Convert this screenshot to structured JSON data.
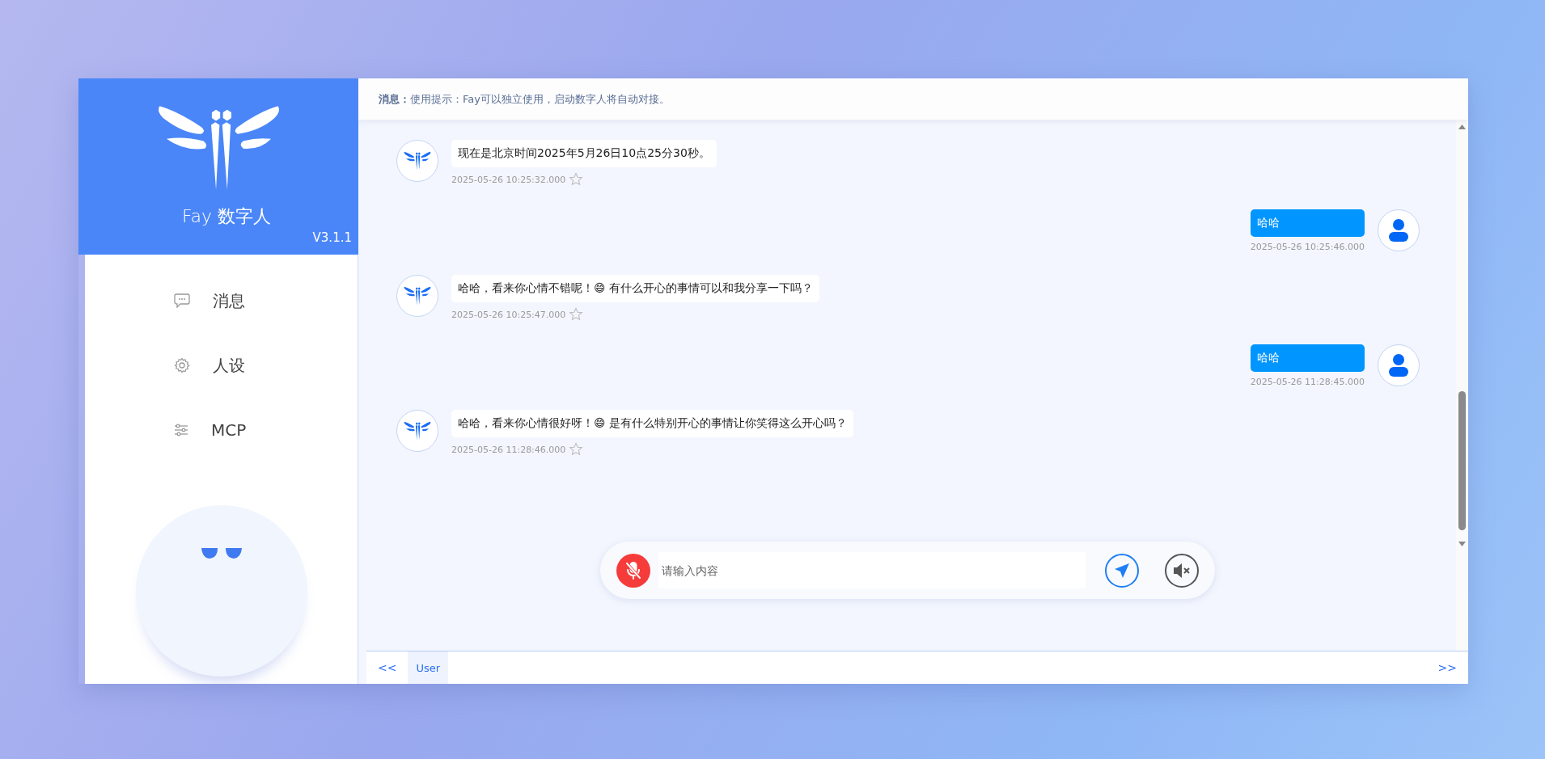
{
  "sidebar": {
    "app_name": "Fay 数字人",
    "version": "V3.1.1",
    "items": [
      {
        "label": "消息"
      },
      {
        "label": "人设"
      },
      {
        "label": "MCP"
      }
    ]
  },
  "header": {
    "label": "消息：",
    "text": "使用提示：Fay可以独立使用，启动数字人将自动对接。"
  },
  "messages": [
    {
      "kind": "bot",
      "text": "现在是北京时间2025年5月26日10点25分30秒。",
      "time": "2025-05-26 10:25:32.000",
      "starred": false
    },
    {
      "kind": "user",
      "text": "哈哈",
      "time": "2025-05-26 10:25:46.000"
    },
    {
      "kind": "bot",
      "text": "哈哈，看来你心情不错呢！😄 有什么开心的事情可以和我分享一下吗？",
      "time": "2025-05-26 10:25:47.000",
      "starred": false
    },
    {
      "kind": "user",
      "text": "哈哈",
      "time": "2025-05-26 11:28:45.000"
    },
    {
      "kind": "bot",
      "text": "哈哈，看来你心情很好呀！😄 是有什么特别开心的事情让你笑得这么开心吗？",
      "time": "2025-05-26 11:28:46.000",
      "starred": false
    }
  ],
  "input": {
    "placeholder": "请输入内容",
    "mic_muted": true,
    "speaker_muted": true
  },
  "tabs": {
    "prev": "<<",
    "next": ">>",
    "items": [
      {
        "label": "User",
        "selected": true
      }
    ]
  }
}
